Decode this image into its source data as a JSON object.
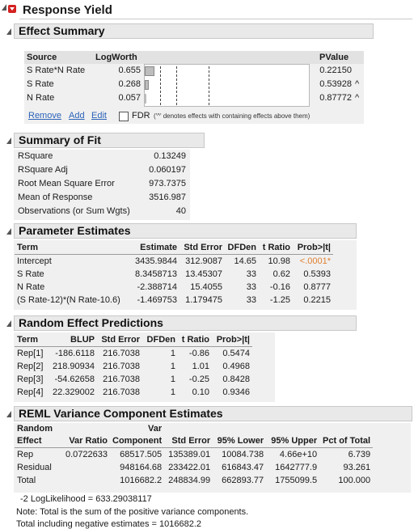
{
  "title": "Response Yield",
  "effect_summary": {
    "title": "Effect Summary",
    "headers": {
      "source": "Source",
      "logworth": "LogWorth",
      "pvalue": "PValue"
    },
    "rows": [
      {
        "source": "S Rate*N Rate",
        "logworth": "0.655",
        "pvalue": "0.22150",
        "mark": ""
      },
      {
        "source": "S Rate",
        "logworth": "0.268",
        "pvalue": "0.53928",
        "mark": "^"
      },
      {
        "source": "N Rate",
        "logworth": "0.057",
        "pvalue": "0.87772",
        "mark": "^"
      }
    ],
    "remove_label": "Remove",
    "add_label": "Add",
    "edit_label": "Edit",
    "fdr_label": "FDR",
    "footnote": "('^' denotes effects with containing effects above them)"
  },
  "summary_of_fit": {
    "title": "Summary of Fit",
    "rows": [
      {
        "label": "RSquare",
        "value": "0.13249"
      },
      {
        "label": "RSquare Adj",
        "value": "0.060197"
      },
      {
        "label": "Root Mean Square Error",
        "value": "973.7375"
      },
      {
        "label": "Mean of Response",
        "value": "3516.987"
      },
      {
        "label": "Observations (or Sum Wgts)",
        "value": "40"
      }
    ]
  },
  "parameter_estimates": {
    "title": "Parameter Estimates",
    "headers": [
      "Term",
      "Estimate",
      "Std Error",
      "DFDen",
      "t Ratio",
      "Prob>|t|"
    ],
    "rows": [
      [
        "Intercept",
        "3435.9844",
        "312.9087",
        "14.65",
        "10.98",
        "<.0001*"
      ],
      [
        "S Rate",
        "8.3458713",
        "13.45307",
        "33",
        "0.62",
        "0.5393"
      ],
      [
        "N Rate",
        "-2.388714",
        "15.4055",
        "33",
        "-0.16",
        "0.8777"
      ],
      [
        "(S Rate-12)*(N Rate-10.6)",
        "-1.469753",
        "1.179475",
        "33",
        "-1.25",
        "0.2215"
      ]
    ]
  },
  "random_effect_predictions": {
    "title": "Random Effect Predictions",
    "headers": [
      "Term",
      "BLUP",
      "Std Error",
      "DFDen",
      "t Ratio",
      "Prob>|t|"
    ],
    "rows": [
      [
        "Rep[1]",
        "-186.6118",
        "216.7038",
        "1",
        "-0.86",
        "0.5474"
      ],
      [
        "Rep[2]",
        "218.90934",
        "216.7038",
        "1",
        "1.01",
        "0.4968"
      ],
      [
        "Rep[3]",
        "-54.62658",
        "216.7038",
        "1",
        "-0.25",
        "0.8428"
      ],
      [
        "Rep[4]",
        "22.329002",
        "216.7038",
        "1",
        "0.10",
        "0.9346"
      ]
    ]
  },
  "reml": {
    "title": "REML Variance Component Estimates",
    "headers_top": [
      "Random",
      "",
      "Var",
      "",
      "",
      "",
      ""
    ],
    "headers": [
      "Effect",
      "Var Ratio",
      "Component",
      "Std Error",
      "95% Lower",
      "95% Upper",
      "Pct of Total"
    ],
    "rows": [
      [
        "Rep",
        "0.0722633",
        "68517.505",
        "135389.01",
        "10084.738",
        "4.66e+10",
        "6.739"
      ],
      [
        "Residual",
        "",
        "948164.68",
        "233422.01",
        "616843.47",
        "1642777.9",
        "93.261"
      ],
      [
        "Total",
        "",
        "1016682.2",
        "248834.99",
        "662893.77",
        "1755099.5",
        "100.000"
      ]
    ],
    "loglik": "-2 LogLikelihood = 633.29038117",
    "note1": "Note: Total is the sum of the positive variance components.",
    "note2": "Total including negative estimates = 1016682.2"
  }
}
